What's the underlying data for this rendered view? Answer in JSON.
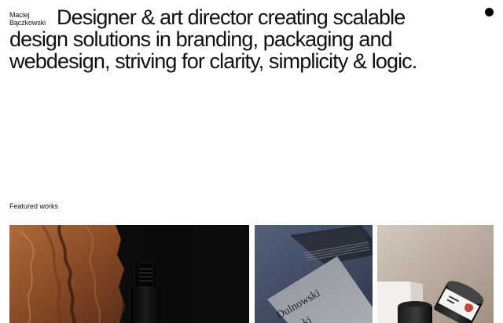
{
  "brand": {
    "first_name": "Maciej",
    "last_name": "Bączkowski"
  },
  "hero": {
    "headline": "Designer & art director creating scalable design solutions in branding, packaging and webdesign, striving for clarity, simplicity & logic."
  },
  "featured": {
    "label": "Featured works",
    "items": [
      {
        "image": "wood-and-wine-bottle-image"
      },
      {
        "image": "business-cards-image",
        "visible_text_1": "Dulnowski",
        "visible_text_2": "ki"
      },
      {
        "image": "jar-packaging-image"
      }
    ]
  },
  "colors": {
    "background": "#ffffff",
    "text": "#111111",
    "menu_dot": "#000000"
  }
}
